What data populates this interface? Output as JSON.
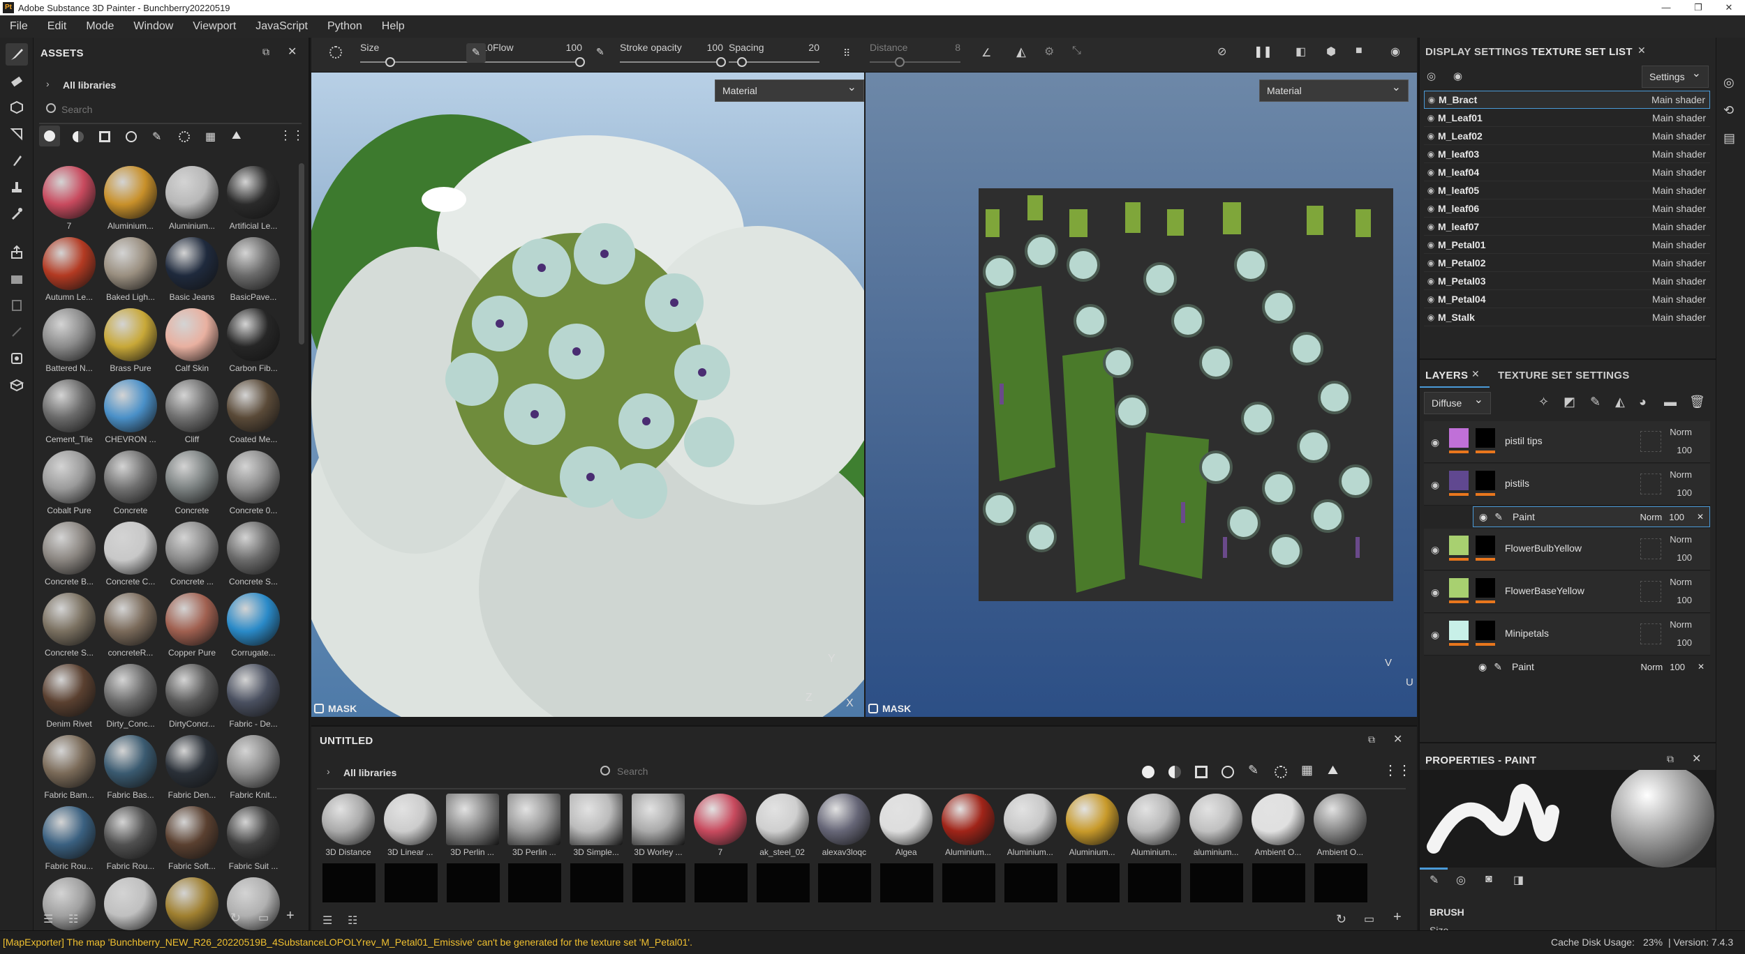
{
  "window": {
    "title": "Adobe Substance 3D Painter - Bunchberry20220519",
    "app_icon_text": "Pt"
  },
  "menu": [
    "File",
    "Edit",
    "Mode",
    "Window",
    "Viewport",
    "JavaScript",
    "Python",
    "Help"
  ],
  "assets": {
    "title": "ASSETS",
    "libraries_label": "All libraries",
    "search_placeholder": "Search",
    "items": [
      {
        "label": "7",
        "color": "#c84a5e"
      },
      {
        "label": "Aluminium...",
        "color": "#c8902a"
      },
      {
        "label": "Aluminium...",
        "color": "#b8b8b8"
      },
      {
        "label": "Artificial Le...",
        "color": "#2a2a2a"
      },
      {
        "label": "Autumn Le...",
        "color": "#b33a22"
      },
      {
        "label": "Baked Ligh...",
        "color": "#9a8f80"
      },
      {
        "label": "Basic Jeans",
        "color": "#1f2a3d"
      },
      {
        "label": "BasicPave...",
        "color": "#6a6a6a"
      },
      {
        "label": "Battered N...",
        "color": "#8a8a8a"
      },
      {
        "label": "Brass Pure",
        "color": "#c8a838"
      },
      {
        "label": "Calf Skin",
        "color": "#e8b0a0"
      },
      {
        "label": "Carbon Fib...",
        "color": "#262626"
      },
      {
        "label": "Cement_Tile",
        "color": "#6a6a6a"
      },
      {
        "label": "CHEVRON ...",
        "color": "#4a90c8"
      },
      {
        "label": "Cliff",
        "color": "#707070"
      },
      {
        "label": "Coated Me...",
        "color": "#5a4a38"
      },
      {
        "label": "Cobalt Pure",
        "color": "#9a9a9a"
      },
      {
        "label": "Concrete",
        "color": "#707070"
      },
      {
        "label": "Concrete",
        "color": "#7a8080"
      },
      {
        "label": "Concrete 0...",
        "color": "#8a8a8a"
      },
      {
        "label": "Concrete B...",
        "color": "#8a8580"
      },
      {
        "label": "Concrete C...",
        "color": "#c8c8c8"
      },
      {
        "label": "Concrete ...",
        "color": "#8a8a8a"
      },
      {
        "label": "Concrete S...",
        "color": "#6a6a6a"
      },
      {
        "label": "Concrete S...",
        "color": "#7a7060"
      },
      {
        "label": "concreteR...",
        "color": "#7a6a5a"
      },
      {
        "label": "Copper Pure",
        "color": "#a06050"
      },
      {
        "label": "Corrugate...",
        "color": "#2a8ac8"
      },
      {
        "label": "Denim Rivet",
        "color": "#5a4030"
      },
      {
        "label": "Dirty_Conc...",
        "color": "#6a6a6a"
      },
      {
        "label": "DirtyConcr...",
        "color": "#5a5a5a"
      },
      {
        "label": "Fabric - De...",
        "color": "#4a5060"
      },
      {
        "label": "Fabric Bam...",
        "color": "#7a6a58"
      },
      {
        "label": "Fabric Bas...",
        "color": "#3a5a70"
      },
      {
        "label": "Fabric Den...",
        "color": "#2a3038"
      },
      {
        "label": "Fabric Knit...",
        "color": "#8a8a8a"
      },
      {
        "label": "Fabric Rou...",
        "color": "#3a6080"
      },
      {
        "label": "Fabric Rou...",
        "color": "#505050"
      },
      {
        "label": "Fabric Soft...",
        "color": "#5a4030"
      },
      {
        "label": "Fabric Suit ...",
        "color": "#404040"
      },
      {
        "label": "",
        "color": "#a0a0a0"
      },
      {
        "label": "",
        "color": "#c0c0c0"
      },
      {
        "label": "",
        "color": "#a08030"
      },
      {
        "label": "",
        "color": "#b0b0b0"
      }
    ]
  },
  "toolbar": {
    "size_label": "Size",
    "size_value": "10",
    "flow_label": "Flow",
    "flow_value": "100",
    "stroke_label": "Stroke opacity",
    "stroke_value": "100",
    "spacing_label": "Spacing",
    "spacing_value": "20",
    "distance_label": "Distance",
    "distance_value": "8"
  },
  "viewport3d": {
    "dropdown": "Material",
    "mask_label": "MASK",
    "axis_x": "X",
    "axis_y": "Y",
    "axis_z": "Z"
  },
  "viewport2d": {
    "dropdown": "Material",
    "mask_label": "MASK",
    "axis_u": "U",
    "axis_v": "V"
  },
  "bottom_shelf": {
    "title": "UNTITLED",
    "libraries_label": "All libraries",
    "search_placeholder": "Search",
    "items": [
      {
        "label": "3D Distance",
        "color": "#aaaaaa"
      },
      {
        "label": "3D Linear ...",
        "color": "#cccccc"
      },
      {
        "label": "3D Perlin ...",
        "color": "#888888"
      },
      {
        "label": "3D Perlin ...",
        "color": "#999999"
      },
      {
        "label": "3D Simple...",
        "color": "#bbbbbb"
      },
      {
        "label": "3D Worley ...",
        "color": "#aaaaaa"
      },
      {
        "label": "7",
        "color": "#c84a5e"
      },
      {
        "label": "ak_steel_02",
        "color": "#cfcfcf"
      },
      {
        "label": "alexav3loqc",
        "color": "#666677"
      },
      {
        "label": "Algea",
        "color": "#dddddd"
      },
      {
        "label": "Aluminium...",
        "color": "#a02418"
      },
      {
        "label": "Aluminium...",
        "color": "#c8c8c8"
      },
      {
        "label": "Aluminium...",
        "color": "#c89a2a"
      },
      {
        "label": "Aluminium...",
        "color": "#b8b8b8"
      },
      {
        "label": "aluminium...",
        "color": "#c0c0c0"
      },
      {
        "label": "Ambient O...",
        "color": "#e0e0e0"
      },
      {
        "label": "Ambient O...",
        "color": "#888888"
      }
    ]
  },
  "display_settings_tab": "DISPLAY SETTINGS",
  "texture_set_list": {
    "title": "TEXTURE SET LIST",
    "settings_label": "Settings",
    "rows": [
      {
        "name": "M_Bract",
        "shader": "Main shader"
      },
      {
        "name": "M_Leaf01",
        "shader": "Main shader"
      },
      {
        "name": "M_Leaf02",
        "shader": "Main shader"
      },
      {
        "name": "M_leaf03",
        "shader": "Main shader"
      },
      {
        "name": "M_leaf04",
        "shader": "Main shader"
      },
      {
        "name": "M_leaf05",
        "shader": "Main shader"
      },
      {
        "name": "M_leaf06",
        "shader": "Main shader"
      },
      {
        "name": "M_leaf07",
        "shader": "Main shader"
      },
      {
        "name": "M_Petal01",
        "shader": "Main shader"
      },
      {
        "name": "M_Petal02",
        "shader": "Main shader"
      },
      {
        "name": "M_Petal03",
        "shader": "Main shader"
      },
      {
        "name": "M_Petal04",
        "shader": "Main shader"
      },
      {
        "name": "M_Stalk",
        "shader": "Main shader"
      }
    ]
  },
  "layers": {
    "title": "LAYERS",
    "settings_tab": "TEXTURE SET SETTINGS",
    "channel": "Diffuse",
    "rows": [
      {
        "name": "pistil tips",
        "blend": "Norm",
        "opacity": "100",
        "swatch": "#c070d8"
      },
      {
        "name": "pistils",
        "blend": "Norm",
        "opacity": "100",
        "swatch": "#604890"
      },
      {
        "name": "FlowerBulbYellow",
        "blend": "Norm",
        "opacity": "100",
        "swatch": "#a8d070"
      },
      {
        "name": "FlowerBaseYellow",
        "blend": "Norm",
        "opacity": "100",
        "swatch": "#a8d070"
      },
      {
        "name": "Minipetals",
        "blend": "Norm",
        "opacity": "100",
        "swatch": "#c8f0e8"
      }
    ],
    "paint_sub1": {
      "name": "Paint",
      "blend": "Norm",
      "opacity": "100"
    },
    "paint_sub2": {
      "name": "Paint",
      "blend": "Norm",
      "opacity": "100"
    }
  },
  "properties": {
    "title": "PROPERTIES - PAINT",
    "brush_header": "BRUSH",
    "size_label": "Size"
  },
  "status": {
    "message": "[MapExporter] The map 'Bunchberry_NEW_R26_20220519B_4SubstanceLOPOLYrev_M_Petal01_Emissive' can't be generated for the texture set 'M_Petal01'.",
    "cache_label": "Cache Disk Usage:",
    "cache_value": "23%",
    "version": "| Version: 7.4.3"
  }
}
